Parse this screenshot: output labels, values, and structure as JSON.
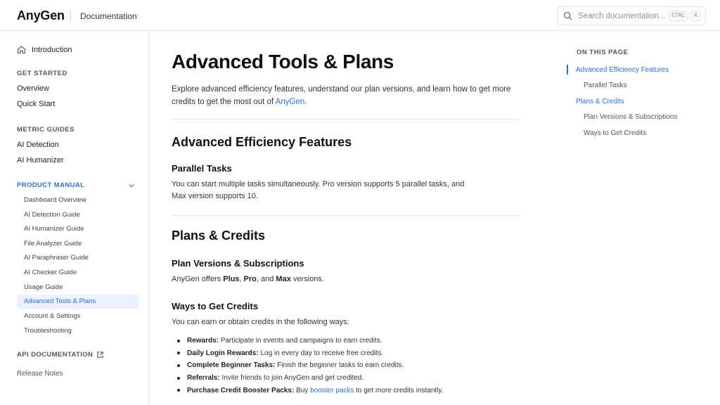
{
  "header": {
    "logo": "AnyGen",
    "section": "Documentation",
    "search_placeholder": "Search documentation...",
    "kbd_ctrl": "CTRL",
    "kbd_k": "K"
  },
  "sidebar": {
    "introduction": "Introduction",
    "get_started": {
      "title": "GET STARTED",
      "items": [
        "Overview",
        "Quick Start"
      ]
    },
    "metric_guides": {
      "title": "METRIC GUIDES",
      "items": [
        "AI Detection",
        "AI Humanizer"
      ]
    },
    "product_manual": {
      "title": "PRODUCT MANUAL",
      "items": [
        "Dashboard Overview",
        "AI Detection Guide",
        "AI Humanizer Guide",
        "File Analyzer Guide",
        "AI Paraphraser Guide",
        "AI Checker Guide",
        "Usage Guide",
        "Advanced Tools & Plans",
        "Account & Settings",
        "Troubleshooting"
      ],
      "active": "Advanced Tools & Plans"
    },
    "api_docs": "API DOCUMENTATION",
    "release_notes": "Release Notes"
  },
  "main": {
    "title": "Advanced Tools & Plans",
    "intro_text": "Explore advanced efficiency features, understand our plan versions, and learn how to get more credits to get the most out of",
    "intro_link": "AnyGen",
    "intro_end": ".",
    "section1": {
      "title": "Advanced Efficiency Features",
      "sub_title": "Parallel Tasks",
      "text": "You can start multiple tasks simultaneously. Pro version supports 5 parallel tasks, and Max version supports 10."
    },
    "section2": {
      "title": "Plans & Credits",
      "sub1_title": "Plan Versions & Subscriptions",
      "sub1_prefix": "AnyGen offers",
      "plan_plus": "Plus",
      "sep1": ",",
      "plan_pro": "Pro",
      "sep2": ", and",
      "plan_max": "Max",
      "sub1_suffix": "versions.",
      "sub2_title": "Ways to Get Credits",
      "sub2_text": "You can earn or obtain credits in the following ways:",
      "bullets": [
        {
          "label": "Rewards:",
          "text": "Participate in events and campaigns to earn credits."
        },
        {
          "label": "Daily Login Rewards:",
          "text": "Log in every day to receive free credits."
        },
        {
          "label": "Complete Beginner Tasks:",
          "text": "Finish the beginner tasks to earn credits."
        },
        {
          "label": "Referrals:",
          "text": "Invite friends to join AnyGen and get credited."
        },
        {
          "label": "Purchase Credit Booster Packs:",
          "text_before": "Buy",
          "link": "booster packs",
          "text_after": "to get more credits instantly."
        }
      ]
    }
  },
  "toc": {
    "title": "ON THIS PAGE",
    "items": [
      "Advanced Efficiency Features",
      "Parallel Tasks",
      "Plans & Credits",
      "Plan Versions & Subscriptions",
      "Ways to Get Credits"
    ]
  },
  "colors": {
    "accent": "#2f6fcb",
    "active_bg": "#eaf1fc",
    "border": "#e6e8eb"
  }
}
